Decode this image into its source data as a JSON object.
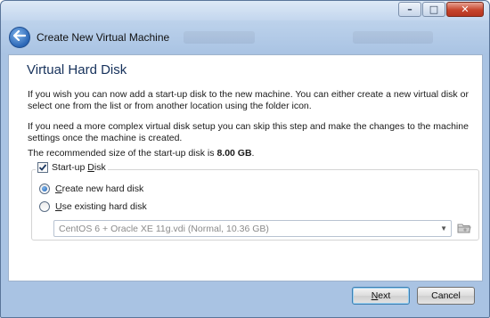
{
  "window": {
    "title": "Create New Virtual Machine",
    "minimize_glyph": "–",
    "maximize_glyph": "□",
    "close_glyph": "✕",
    "back_icon": "back-arrow-icon"
  },
  "page": {
    "heading": "Virtual Hard Disk",
    "para1": "If you wish you can now add a start-up disk to the new machine. You can either create a new virtual disk or select one from the list or from another location using the folder icon.",
    "para2": "If you need a more complex virtual disk setup you can skip this step and make the changes to the machine settings once the machine is created.",
    "recommended_prefix": "The recommended size of the start-up disk is ",
    "recommended_size": "8.00 GB",
    "recommended_suffix": "."
  },
  "startup_disk": {
    "label_pre": "Start-up ",
    "label_acc": "D",
    "label_post": "isk",
    "checked": true,
    "create_new": {
      "label_acc": "C",
      "label_post": "reate new hard disk",
      "selected": true
    },
    "use_existing": {
      "label_acc": "U",
      "label_post": "se existing hard disk",
      "selected": false
    },
    "existing_disk_value": "CentOS 6 + Oracle XE 11g.vdi (Normal, 10.36 GB)",
    "folder_icon": "folder-icon"
  },
  "footer": {
    "next_acc": "N",
    "next_post": "ext",
    "cancel_label": "Cancel"
  },
  "colors": {
    "heading": "#16315b",
    "accent": "#1d5fb3"
  }
}
